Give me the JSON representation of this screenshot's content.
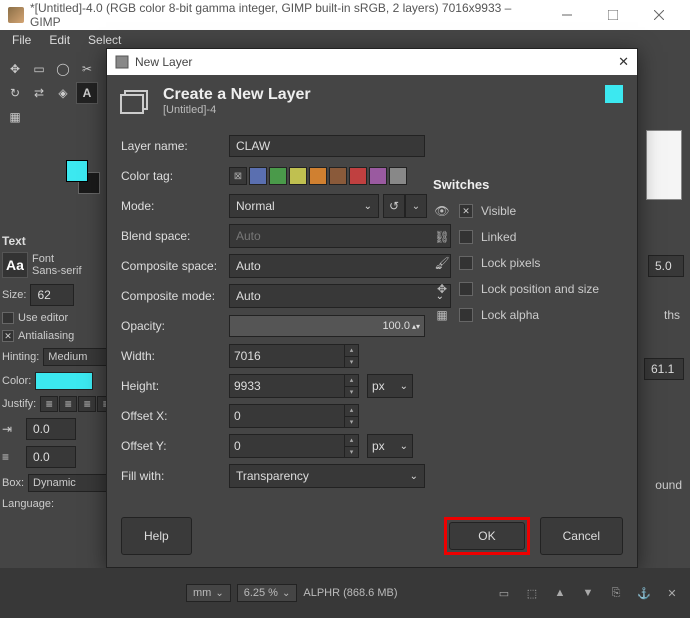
{
  "titlebar": {
    "text": "*[Untitled]-4.0 (RGB color 8-bit gamma integer, GIMP built-in sRGB, 2 layers) 7016x9933 – GIMP"
  },
  "menubar": {
    "items": [
      "File",
      "Edit",
      "Select"
    ]
  },
  "leftpanel": {
    "text_hdr": "Text",
    "font_lbl": "Font",
    "font_val": "Sans-serif",
    "size_lbl": "Size:",
    "size_val": "62",
    "use_editor": "Use editor",
    "antialias": "Antialiasing",
    "hinting_lbl": "Hinting:",
    "hinting_val": "Medium",
    "color_lbl": "Color:",
    "justify_lbl": "Justify:",
    "indent_val": "0.0",
    "spacing_val": "0.0",
    "box_lbl": "Box:",
    "box_val": "Dynamic",
    "lang_lbl": "Language:"
  },
  "dialog": {
    "title": "New Layer",
    "header": "Create a New Layer",
    "subheader": "[Untitled]-4",
    "labels": {
      "layer_name": "Layer name:",
      "color_tag": "Color tag:",
      "mode": "Mode:",
      "blend_space": "Blend space:",
      "composite_space": "Composite space:",
      "composite_mode": "Composite mode:",
      "opacity": "Opacity:",
      "width": "Width:",
      "height": "Height:",
      "offset_x": "Offset X:",
      "offset_y": "Offset Y:",
      "fill_with": "Fill with:"
    },
    "values": {
      "layer_name": "CLAW",
      "mode": "Normal",
      "blend_space": "Auto",
      "composite_space": "Auto",
      "composite_mode": "Auto",
      "opacity": "100.0",
      "width": "7016",
      "height": "9933",
      "offset_x": "0",
      "offset_y": "0",
      "fill_with": "Transparency",
      "unit": "px"
    },
    "color_tags": [
      "#383838",
      "#5a6fb0",
      "#4a9a4a",
      "#c0c050",
      "#d08030",
      "#8a5a3a",
      "#c04040",
      "#9a5aa0",
      "#888888"
    ],
    "switches": {
      "title": "Switches",
      "items": [
        {
          "icon": "eye",
          "label": "Visible",
          "checked": true
        },
        {
          "icon": "link",
          "label": "Linked",
          "checked": false
        },
        {
          "icon": "brush",
          "label": "Lock pixels",
          "checked": false
        },
        {
          "icon": "move",
          "label": "Lock position and size",
          "checked": false
        },
        {
          "icon": "alpha",
          "label": "Lock alpha",
          "checked": false
        }
      ]
    },
    "buttons": {
      "help": "Help",
      "ok": "OK",
      "cancel": "Cancel"
    }
  },
  "right": {
    "spin_val": "5.0",
    "spin_val2": "61.1",
    "ths": "ths",
    "ound": "ound"
  },
  "statusbar": {
    "unit": "mm",
    "zoom": "6.25 %",
    "mem": "ALPHR (868.6 MB)"
  }
}
